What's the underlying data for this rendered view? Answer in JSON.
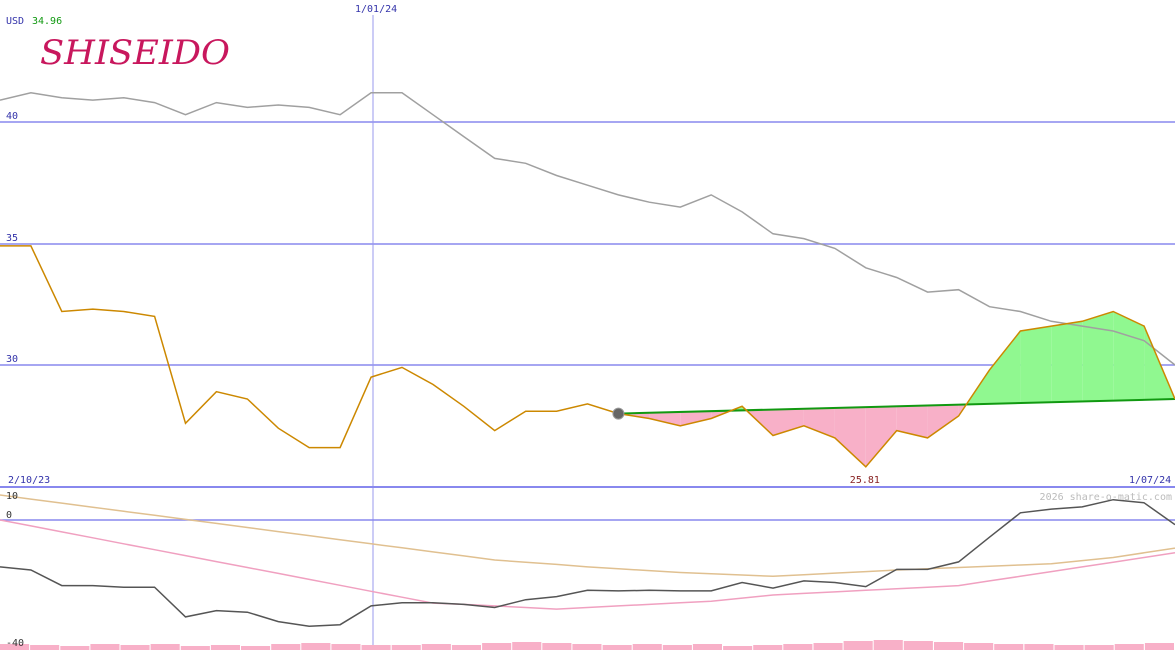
{
  "header": {
    "currency": "USD",
    "last_price": "34.96",
    "logo_text": "SHISEIDO"
  },
  "watermark": "2026 share-o-matic.com",
  "colors": {
    "price_line": "#cc8800",
    "upper_line": "#a0a0a0",
    "trend_line": "#119911",
    "gain_fill": "#90f890",
    "loss_fill": "#f8b0c8",
    "grid": "#8888ee",
    "axis_text": "#3333aa",
    "logo": "#c8175d",
    "volume": "#f8b0c8",
    "osc_black": "#555555",
    "osc_pink": "#f0a0c0",
    "osc_tan": "#e0c090"
  },
  "chart_data": [
    {
      "type": "line",
      "title": "",
      "x_start_label": "2/10/23",
      "x_end_label": "1/07/24",
      "marker_label": "1/01/24",
      "min_label": "25.81",
      "y_ticks": [
        "40",
        "35",
        "30"
      ],
      "ylim": [
        25.0,
        44.8
      ],
      "grid": true,
      "x": [
        0,
        1,
        2,
        3,
        4,
        5,
        6,
        7,
        8,
        9,
        10,
        11,
        12,
        13,
        14,
        15,
        16,
        17,
        18,
        19,
        20,
        21,
        22,
        23,
        24,
        25,
        26,
        27,
        28,
        29,
        30,
        31,
        32,
        33,
        34,
        35,
        36,
        37,
        38
      ],
      "series": [
        {
          "name": "",
          "role": "upper",
          "values": [
            40.9,
            41.2,
            41.0,
            40.9,
            41.0,
            40.8,
            40.3,
            40.8,
            40.6,
            40.7,
            40.6,
            40.3,
            41.2,
            41.2,
            40.3,
            39.4,
            38.5,
            38.3,
            37.8,
            37.4,
            37.0,
            36.7,
            36.5,
            37.0,
            36.3,
            35.4,
            35.2,
            34.8,
            34.0,
            33.6,
            33.0,
            33.1,
            32.4,
            32.2,
            31.8,
            31.6,
            31.4,
            31.0,
            30.0
          ]
        },
        {
          "name": "",
          "role": "price",
          "values": [
            34.9,
            34.9,
            32.2,
            32.3,
            32.2,
            32.0,
            27.6,
            28.9,
            28.6,
            27.4,
            26.6,
            26.6,
            29.5,
            29.9,
            29.2,
            28.3,
            27.3,
            28.1,
            28.1,
            28.4,
            28.0,
            27.8,
            27.5,
            27.8,
            28.3,
            27.1,
            27.5,
            27.0,
            25.81,
            27.3,
            27.0,
            27.9,
            29.8,
            31.4,
            31.6,
            31.8,
            32.2,
            31.6,
            28.6
          ]
        },
        {
          "name": "",
          "role": "trend",
          "start_index": 20,
          "end_index": 38,
          "start_value": 28.0,
          "end_value": 28.6
        }
      ]
    },
    {
      "type": "line",
      "title": "",
      "y_ticks": [
        "10",
        "0",
        "-40"
      ],
      "ylim": [
        -40,
        10
      ],
      "x": [
        0,
        1,
        2,
        3,
        4,
        5,
        6,
        7,
        8,
        9,
        10,
        11,
        12,
        13,
        14,
        15,
        16,
        17,
        18,
        19,
        20,
        21,
        22,
        23,
        24,
        25,
        26,
        27,
        28,
        29,
        30,
        31,
        32,
        33,
        34,
        35,
        36,
        37,
        38
      ],
      "series": [
        {
          "name": "",
          "role": "black",
          "values": [
            -15,
            -16,
            -21,
            -21,
            -21.5,
            -21.5,
            -31,
            -29,
            -29.5,
            -32.5,
            -34,
            -33.5,
            -27.5,
            -26.5,
            -26.5,
            -27,
            -28,
            -25.5,
            -24.5,
            -22.5,
            -22.7,
            -22.5,
            -22.7,
            -22.7,
            -20,
            -21.8,
            -19.5,
            -20,
            -21.3,
            -15.8,
            -15.8,
            -13.4,
            -5.5,
            2.3,
            3.5,
            4.2,
            6.5,
            5.5,
            -1.5
          ]
        },
        {
          "name": "",
          "role": "pink",
          "values": [
            0,
            -1.9,
            -3.8,
            -5.7,
            -7.6,
            -9.5,
            -11.4,
            -13.3,
            -15.2,
            -17.1,
            -19,
            -20.9,
            -22.8,
            -24.7,
            -26.6,
            -27,
            -27.5,
            -28,
            -28.5,
            -28,
            -27.5,
            -27,
            -26.5,
            -26,
            -25,
            -24,
            -23.5,
            -23,
            -22.5,
            -22,
            -21.5,
            -21,
            -19.5,
            -18,
            -16.5,
            -15,
            -13.5,
            -12,
            -10.5
          ]
        },
        {
          "name": "",
          "role": "tan",
          "values": [
            8,
            6.7,
            5.4,
            4.1,
            2.8,
            1.5,
            0.2,
            -1.1,
            -2.4,
            -3.7,
            -5,
            -6.3,
            -7.6,
            -8.9,
            -10.2,
            -11.5,
            -12.8,
            -13.5,
            -14.2,
            -15,
            -15.6,
            -16.2,
            -16.8,
            -17.2,
            -17.6,
            -18,
            -17.5,
            -17,
            -16.5,
            -16,
            -15.6,
            -15.2,
            -14.8,
            -14.4,
            -14,
            -13,
            -12,
            -10.5,
            -9
          ]
        }
      ]
    }
  ]
}
